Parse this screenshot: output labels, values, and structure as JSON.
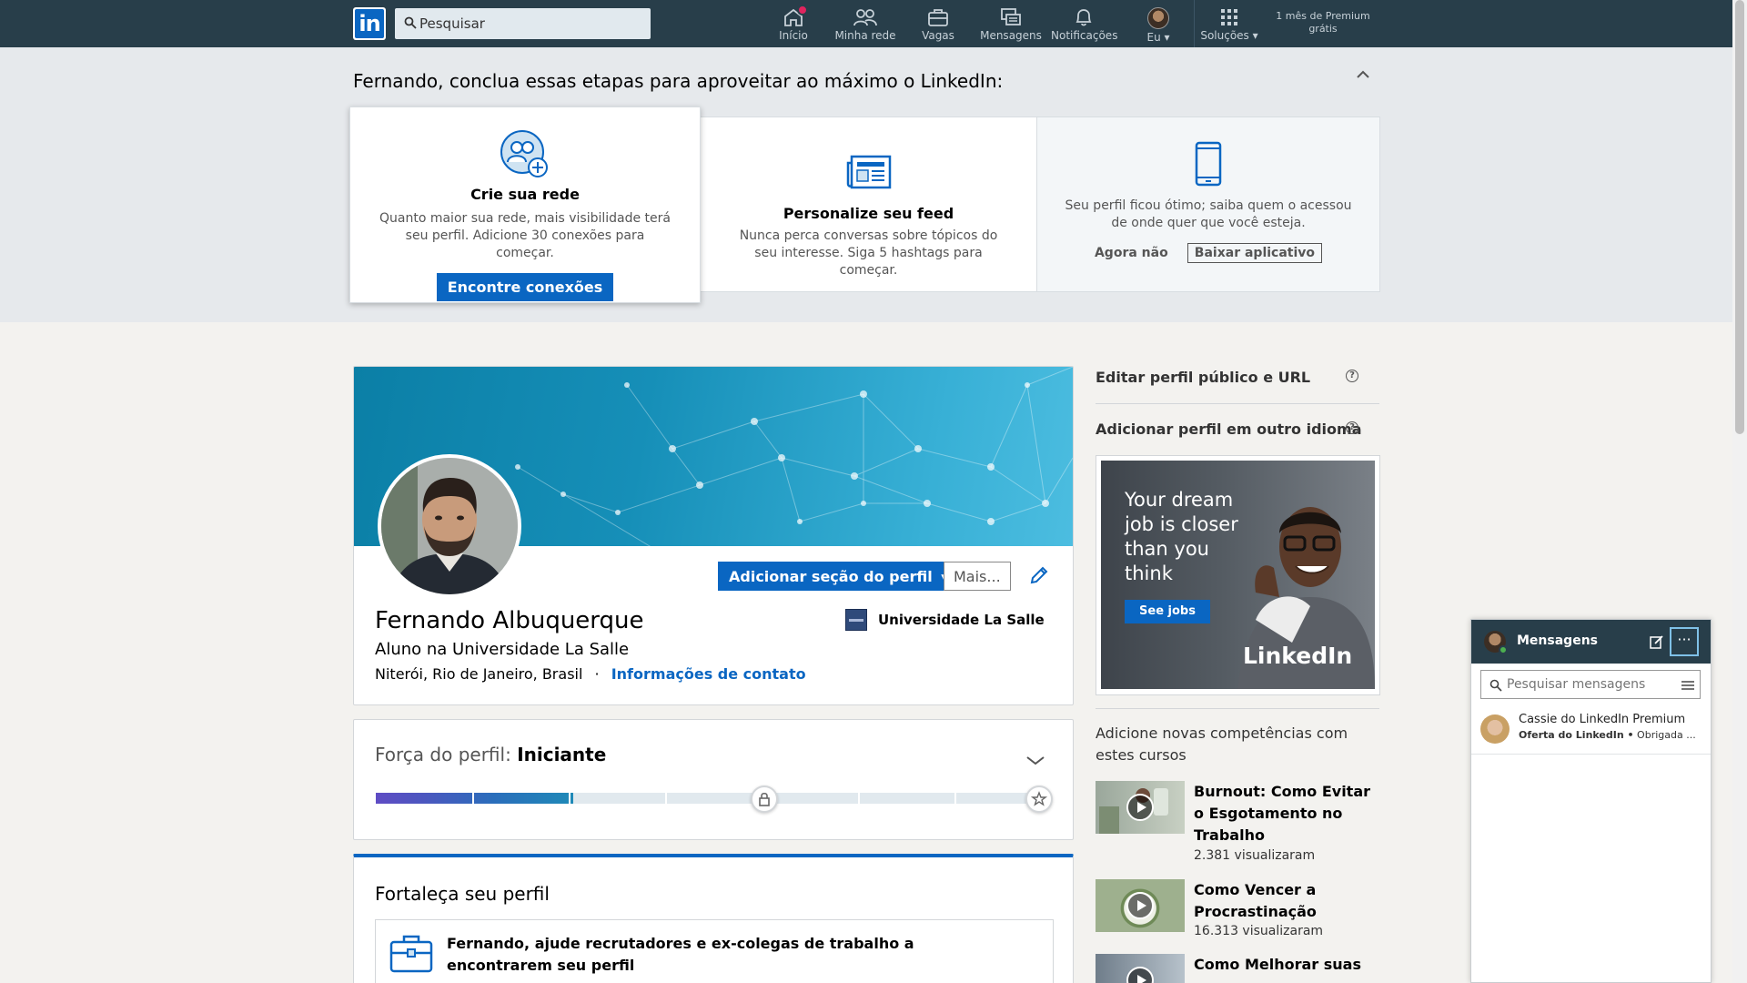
{
  "nav": {
    "logo": "in",
    "search_placeholder": "Pesquisar",
    "items": [
      {
        "label": "Início",
        "icon": "home-icon",
        "badge": true
      },
      {
        "label": "Minha rede",
        "icon": "people-icon"
      },
      {
        "label": "Vagas",
        "icon": "briefcase-icon"
      },
      {
        "label": "Mensagens",
        "icon": "messages-icon"
      },
      {
        "label": "Notificações",
        "icon": "bell-icon"
      },
      {
        "label": "Eu",
        "icon": "avatar"
      },
      {
        "label": "Soluções",
        "icon": "grid-icon"
      }
    ],
    "premium": "1 mês de Premium grátis"
  },
  "onboarding": {
    "title": "Fernando, conclua essas etapas para aproveitar ao máximo o LinkedIn:",
    "cards": [
      {
        "title": "Crie sua rede",
        "text": "Quanto maior sua rede, mais visibilidade terá seu perfil. Adicione 30 conexões para começar.",
        "button": "Encontre conexões"
      },
      {
        "title": "Personalize seu feed",
        "text": "Nunca perca conversas sobre tópicos do seu interesse. Siga 5 hashtags para começar."
      },
      {
        "text": "Seu perfil ficou ótimo; saiba quem o acessou de onde quer que você esteja.",
        "dismiss": "Agora não",
        "button": "Baixar aplicativo"
      }
    ]
  },
  "profile": {
    "name": "Fernando Albuquerque",
    "headline": "Aluno na Universidade La Salle",
    "location": "Niterói, Rio de Janeiro, Brasil",
    "separator": "·",
    "contact_link": "Informações de contato",
    "add_section": "Adicionar seção do perfil",
    "more": "Mais...",
    "school": "Universidade La Salle"
  },
  "strength": {
    "label": "Força do perfil:",
    "level": "Iniciante",
    "progress_fraction": 0.3
  },
  "strengthen": {
    "title": "Fortaleça seu perfil",
    "card_text": "Fernando, ajude recrutadores e ex-colegas de trabalho a encontrarem seu perfil"
  },
  "sidebar": {
    "edit_public": "Editar perfil público e URL",
    "other_lang": "Adicionar perfil em outro idioma",
    "ad": {
      "headline": "Your dream job is closer than you think",
      "button": "See jobs",
      "brand": "LinkedIn"
    },
    "courses_title": "Adicione novas competências com estes cursos",
    "courses": [
      {
        "title": "Burnout: Como Evitar o Esgotamento no Trabalho",
        "views": "2.381 visualizaram"
      },
      {
        "title": "Como Vencer a Procrastinação",
        "views": "16.313 visualizaram"
      },
      {
        "title": "Como Melhorar suas"
      }
    ]
  },
  "messaging": {
    "title": "Mensagens",
    "search_placeholder": "Pesquisar mensagens",
    "conversations": [
      {
        "name": "Cassie do LinkedIn Premium",
        "sender": "Oferta do LinkedIn •",
        "preview": "Obrigada ..."
      }
    ]
  },
  "colors": {
    "nav_bg": "#283e4a",
    "brand_blue": "#0a66c2",
    "page_bg": "#f3f2ef"
  }
}
